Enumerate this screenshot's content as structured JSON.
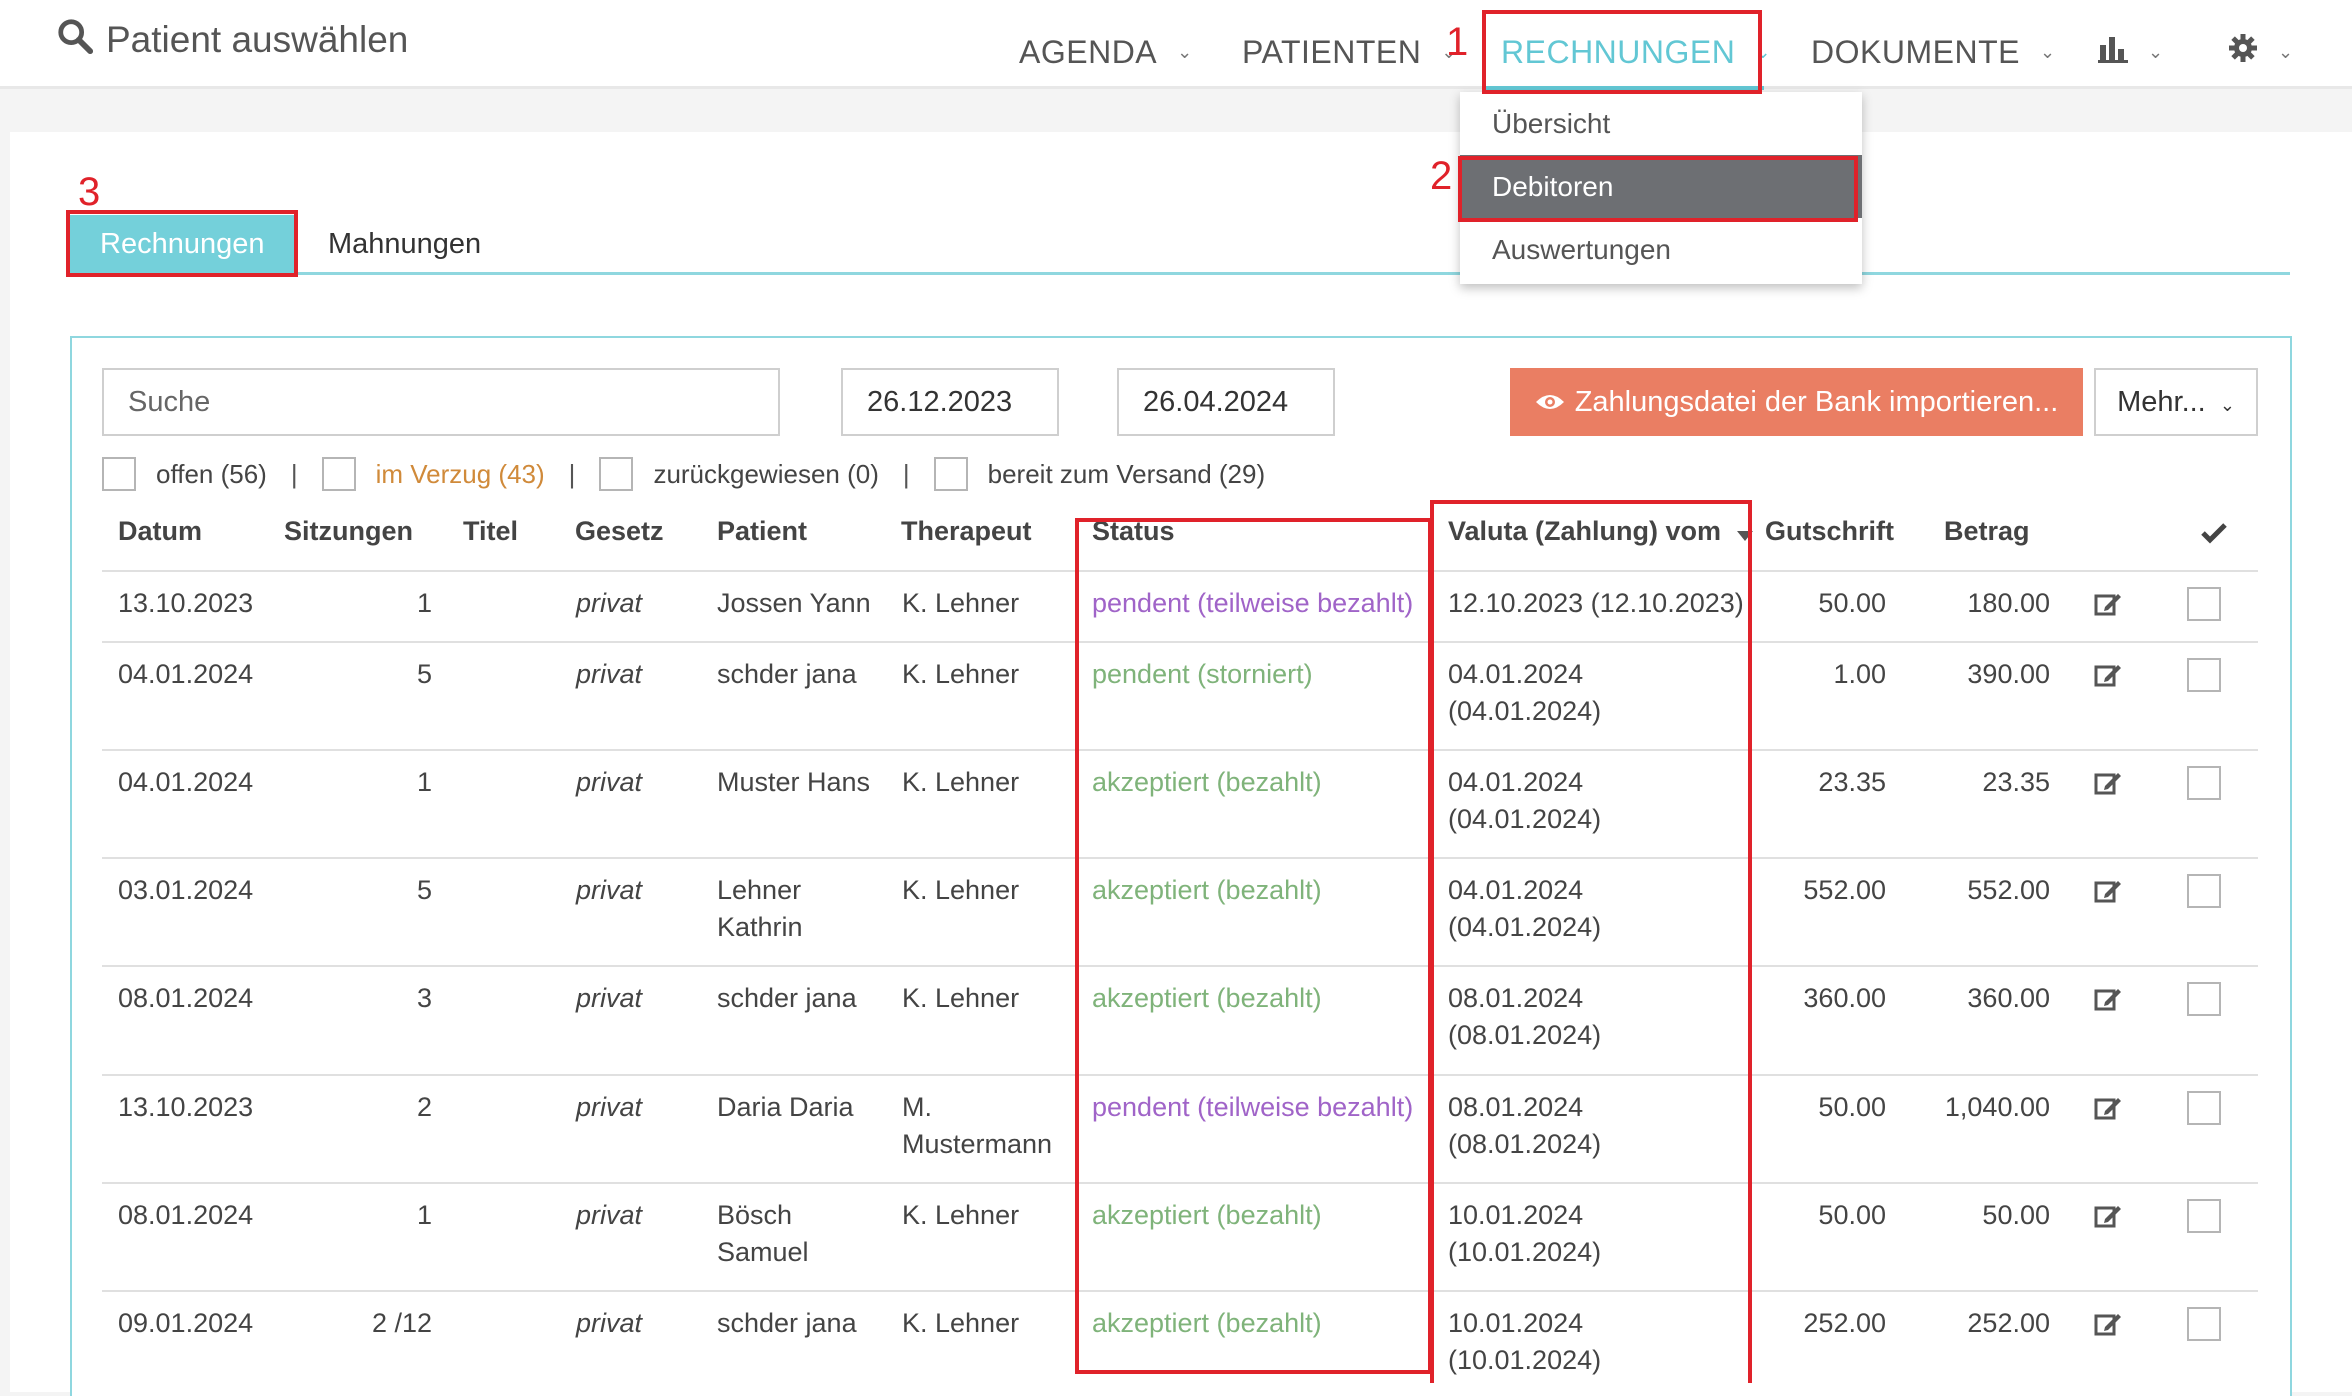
{
  "header": {
    "patient_search_label": "Patient auswählen",
    "nav": [
      {
        "label": "AGENDA"
      },
      {
        "label": "PATIENTEN"
      },
      {
        "label": "RECHNUNGEN"
      },
      {
        "label": "DOKUMENTE"
      }
    ],
    "stats_icon": "bar-chart-icon",
    "settings_icon": "gear-icon"
  },
  "dropdown": {
    "items": [
      "Übersicht",
      "Debitoren",
      "Auswertungen"
    ],
    "selected": "Debitoren"
  },
  "annotations": [
    "1",
    "2",
    "3"
  ],
  "tabs": [
    "Rechnungen",
    "Mahnungen"
  ],
  "toolbar": {
    "search_placeholder": "Suche",
    "date_from": "26.12.2023",
    "date_to": "26.04.2024",
    "import_button": "Zahlungsdatei der Bank importieren...",
    "more_button": "Mehr..."
  },
  "filters": [
    {
      "label": "offen (56)"
    },
    {
      "label": "im Verzug (43)"
    },
    {
      "label": "zurückgewiesen (0)"
    },
    {
      "label": "bereit zum Versand (29)"
    }
  ],
  "filter_separator": "|",
  "table": {
    "columns": [
      "Datum",
      "Sitzungen",
      "Titel",
      "Gesetz",
      "Patient",
      "Therapeut",
      "Status",
      "Valuta (Zahlung) vom",
      "Gutschrift",
      "Betrag"
    ],
    "sort_icon": "caret-down-icon",
    "check_all_icon": "checkmark-icon",
    "rows": [
      {
        "datum": "13.10.2023",
        "sitzungen": "1",
        "gesetz": "privat",
        "patient": "Jossen Yann",
        "therapeut": "K. Lehner",
        "status": "pendent (teilweise bezahlt)",
        "status_kind": "pending",
        "valuta": "12.10.2023 (12.10.2023)",
        "gutschrift": "50.00",
        "betrag": "180.00"
      },
      {
        "datum": "04.01.2024",
        "sitzungen": "5",
        "gesetz": "privat",
        "patient": "schder jana",
        "therapeut": "K. Lehner",
        "status": "pendent (storniert)",
        "status_kind": "ok",
        "valuta": "04.01.2024 (04.01.2024)",
        "gutschrift": "1.00",
        "betrag": "390.00"
      },
      {
        "datum": "04.01.2024",
        "sitzungen": "1",
        "gesetz": "privat",
        "patient": "Muster Hans",
        "therapeut": "K. Lehner",
        "status": "akzeptiert (bezahlt)",
        "status_kind": "ok",
        "valuta": "04.01.2024 (04.01.2024)",
        "gutschrift": "23.35",
        "betrag": "23.35"
      },
      {
        "datum": "03.01.2024",
        "sitzungen": "5",
        "gesetz": "privat",
        "patient": "Lehner Kathrin",
        "therapeut": "K. Lehner",
        "status": "akzeptiert (bezahlt)",
        "status_kind": "ok",
        "valuta": "04.01.2024 (04.01.2024)",
        "gutschrift": "552.00",
        "betrag": "552.00"
      },
      {
        "datum": "08.01.2024",
        "sitzungen": "3",
        "gesetz": "privat",
        "patient": "schder jana",
        "therapeut": "K. Lehner",
        "status": "akzeptiert (bezahlt)",
        "status_kind": "ok",
        "valuta": "08.01.2024 (08.01.2024)",
        "gutschrift": "360.00",
        "betrag": "360.00"
      },
      {
        "datum": "13.10.2023",
        "sitzungen": "2",
        "gesetz": "privat",
        "patient": "Daria Daria",
        "therapeut": "M. Mustermann",
        "status": "pendent (teilweise bezahlt)",
        "status_kind": "pending",
        "valuta": "08.01.2024 (08.01.2024)",
        "gutschrift": "50.00",
        "betrag": "1,040.00"
      },
      {
        "datum": "08.01.2024",
        "sitzungen": "1",
        "gesetz": "privat",
        "patient": "Bösch Samuel",
        "therapeut": "K. Lehner",
        "status": "akzeptiert (bezahlt)",
        "status_kind": "ok",
        "valuta": "10.01.2024 (10.01.2024)",
        "gutschrift": "50.00",
        "betrag": "50.00"
      },
      {
        "datum": "09.01.2024",
        "sitzungen": "2 /12",
        "gesetz": "privat",
        "patient": "schder jana",
        "therapeut": "K. Lehner",
        "status": "akzeptiert (bezahlt)",
        "status_kind": "ok",
        "valuta": "10.01.2024 (10.01.2024)",
        "gutschrift": "252.00",
        "betrag": "252.00"
      }
    ]
  },
  "colors": {
    "accent": "#62c7d4",
    "tab_active": "#74d0da",
    "import_button": "#ea7e63",
    "status_ok": "#7fb37a",
    "status_pending": "#a064c8",
    "warning": "#d08a3a",
    "highlight": "#e0222a"
  }
}
